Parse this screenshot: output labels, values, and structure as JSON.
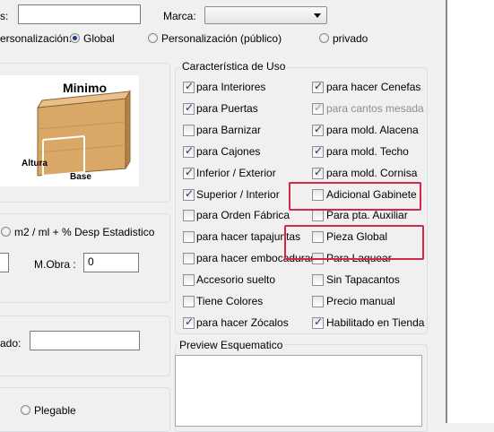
{
  "top": {
    "label_cut": "s:",
    "marca_label": "Marca:",
    "marca_value": "",
    "personalizacion_label": "ersonalización:",
    "global_label": "Global",
    "publico_label": "Personalización (público)",
    "privado_label": "privado"
  },
  "diagram": {
    "title": "Minimo",
    "altura_label": "Altura",
    "base_label": "Base"
  },
  "calc": {
    "option_label": "m2 / ml + % Desp Estadistico",
    "mobra_label": "M.Obra :",
    "mobra_value": "0"
  },
  "lower": {
    "field_label": "ado:",
    "plegable_label": "Plegable"
  },
  "caracteristica": {
    "title": "Característica de Uso",
    "left": [
      {
        "label": "para Interiores",
        "checked": true
      },
      {
        "label": "para Puertas",
        "checked": true
      },
      {
        "label": "para Barnizar",
        "checked": false
      },
      {
        "label": "para Cajones",
        "checked": true
      },
      {
        "label": "Inferior / Exterior",
        "checked": true
      },
      {
        "label": "Superior / Interior",
        "checked": true
      },
      {
        "label": "para Orden Fábrica",
        "checked": false
      },
      {
        "label": "para hacer tapajuntas",
        "checked": false
      },
      {
        "label": "para hacer embocaduras",
        "checked": false
      },
      {
        "label": "Accesorio suelto",
        "checked": false
      },
      {
        "label": "Tiene Colores",
        "checked": false
      },
      {
        "label": "para hacer Zócalos",
        "checked": true
      }
    ],
    "right": [
      {
        "label": "para hacer Cenefas",
        "checked": true,
        "disabled": false
      },
      {
        "label": "para cantos mesada",
        "checked": true,
        "disabled": true
      },
      {
        "label": "para mold. Alacena",
        "checked": true,
        "disabled": false
      },
      {
        "label": "para mold. Techo",
        "checked": true,
        "disabled": false
      },
      {
        "label": "para mold. Cornisa",
        "checked": true,
        "disabled": false
      },
      {
        "label": "Adicional Gabinete",
        "checked": false,
        "disabled": false
      },
      {
        "label": "Para pta. Auxiliar",
        "checked": false,
        "disabled": false
      },
      {
        "label": "Pieza Global",
        "checked": false,
        "disabled": false
      },
      {
        "label": "Para Laquear",
        "checked": false,
        "disabled": false
      },
      {
        "label": "Sin Tapacantos",
        "checked": false,
        "disabled": false
      },
      {
        "label": "Precio manual",
        "checked": false,
        "disabled": false
      },
      {
        "label": "Habilitado en Tienda",
        "checked": true,
        "disabled": false
      }
    ]
  },
  "preview": {
    "title": "Preview Esquematico"
  },
  "colors": {
    "highlight": "#d6264c",
    "checkmark": "#1d3b73",
    "group_border": "#d5dfe5",
    "wood": "#d9a766"
  }
}
